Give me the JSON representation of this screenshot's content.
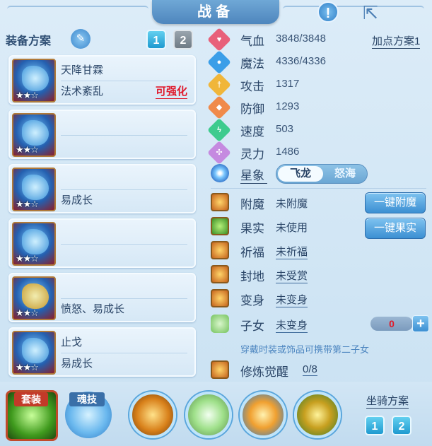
{
  "title": "战备",
  "left": {
    "plan_label": "装备方案",
    "plan_buttons": [
      "1",
      "2"
    ],
    "cards": [
      {
        "name": "天降甘霖",
        "desc": "法术紊乱",
        "tag": "可强化",
        "stars": "★★☆"
      },
      {
        "name": "",
        "desc": "",
        "tag": "",
        "stars": "★★☆"
      },
      {
        "name": "",
        "desc": "易成长",
        "tag": "",
        "stars": "★★☆"
      },
      {
        "name": "",
        "desc": "",
        "tag": "",
        "stars": "★★☆"
      },
      {
        "name": "",
        "desc": "愤怒、易成长",
        "tag": "",
        "stars": "★★☆"
      },
      {
        "name": "止戈",
        "desc": "易成长",
        "tag": "",
        "stars": "★★☆"
      }
    ]
  },
  "stats": {
    "add_points": "加点方案1",
    "rows": [
      {
        "name": "气血",
        "value": "3848/3848",
        "icon": "heart-icon",
        "color": "#e8607a"
      },
      {
        "name": "魔法",
        "value": "4336/4336",
        "icon": "mana-icon",
        "color": "#3a9ee8"
      },
      {
        "name": "攻击",
        "value": "1317",
        "icon": "sword-icon",
        "color": "#f0b63a"
      },
      {
        "name": "防御",
        "value": "1293",
        "icon": "shield-icon",
        "color": "#f08a4a"
      },
      {
        "name": "速度",
        "value": "503",
        "icon": "lightning-icon",
        "color": "#3ecb8e"
      },
      {
        "name": "灵力",
        "value": "1486",
        "icon": "spirit-icon",
        "color": "#c58ae0"
      }
    ]
  },
  "star_sign": {
    "label": "星象",
    "options": [
      "飞龙",
      "怒海"
    ],
    "selected": "飞龙"
  },
  "features": [
    {
      "name": "附魔",
      "value": "未附魔",
      "underline": false,
      "button": "一键附魔"
    },
    {
      "name": "果实",
      "value": "未使用",
      "underline": false,
      "button": "一键果实"
    },
    {
      "name": "祈福",
      "value": "未祈福",
      "underline": true,
      "button": ""
    },
    {
      "name": "封地",
      "value": "未受赏",
      "underline": true,
      "button": ""
    },
    {
      "name": "变身",
      "value": "未变身",
      "underline": true,
      "button": ""
    },
    {
      "name": "子女",
      "value": "未变身",
      "underline": true,
      "button": ""
    },
    {
      "name": "修炼觉醒",
      "value": "0/8",
      "underline": true,
      "button": ""
    }
  ],
  "child_counter": "0",
  "child_plus": "+",
  "hint": "穿戴时装或饰品可携带第二子女",
  "bottom": {
    "suit_label": "套装",
    "soul_label": "魂技",
    "mount_label": "坐骑方案",
    "mount_buttons": [
      "1",
      "2"
    ]
  },
  "icons": {
    "info": "!",
    "share": "⇱",
    "pen": "✎"
  }
}
